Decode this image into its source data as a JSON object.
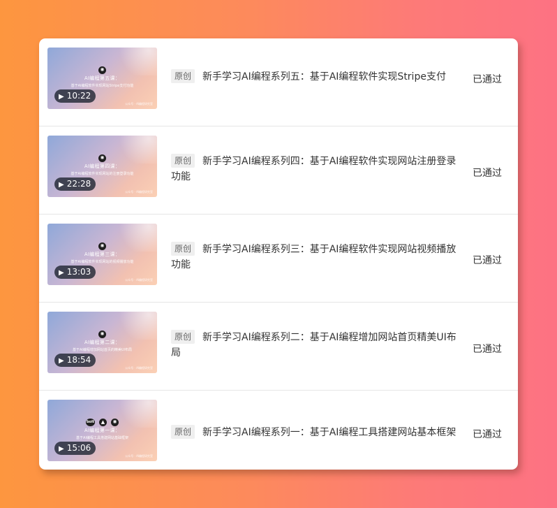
{
  "videos": [
    {
      "tag": "原创",
      "title": "新手学习AI编程系列五：基于AI编程软件实现Stripe支付",
      "status": "已通过",
      "duration": "10:22",
      "thumb_title": "AI编程第五课：",
      "thumb_sub": "基于AI编程软件实现网站Stripe支付功能",
      "thumb_watermark": "公众号 · AI编程研究室",
      "logos": [
        "openai"
      ]
    },
    {
      "tag": "原创",
      "title": "新手学习AI编程系列四：基于AI编程软件实现网站注册登录功能",
      "status": "已通过",
      "duration": "22:28",
      "thumb_title": "AI编程第四课：",
      "thumb_sub": "基于AI编程软件实现网站的注册登录功能",
      "thumb_watermark": "公众号 · AI编程研究室",
      "logos": [
        "openai"
      ]
    },
    {
      "tag": "原创",
      "title": "新手学习AI编程系列三：基于AI编程软件实现网站视频播放功能",
      "status": "已通过",
      "duration": "13:03",
      "thumb_title": "AI编程第三课：",
      "thumb_sub": "基于AI编程软件实现网站的视频播放功能",
      "thumb_watermark": "公众号 · AI编程研究室",
      "logos": [
        "openai"
      ]
    },
    {
      "tag": "原创",
      "title": "新手学习AI编程系列二：基于AI编程增加网站首页精美UI布局",
      "status": "已通过",
      "duration": "18:54",
      "thumb_title": "AI编程第二课：",
      "thumb_sub": "基于AI编程增加网站首页的精美UI布局",
      "thumb_watermark": "公众号 · AI编程研究室",
      "logos": [
        "openai"
      ]
    },
    {
      "tag": "原创",
      "title": "新手学习AI编程系列一：基于AI编程工具搭建网站基本框架",
      "status": "已通过",
      "duration": "15:06",
      "thumb_title": "AI编程第一课：",
      "thumb_sub": "基于AI编程工具搭建网站基础框架",
      "thumb_watermark": "公众号 · AI编程研究室",
      "logos": [
        "bolt",
        "vercel",
        "openai"
      ],
      "bolt_text": "bolt"
    }
  ]
}
